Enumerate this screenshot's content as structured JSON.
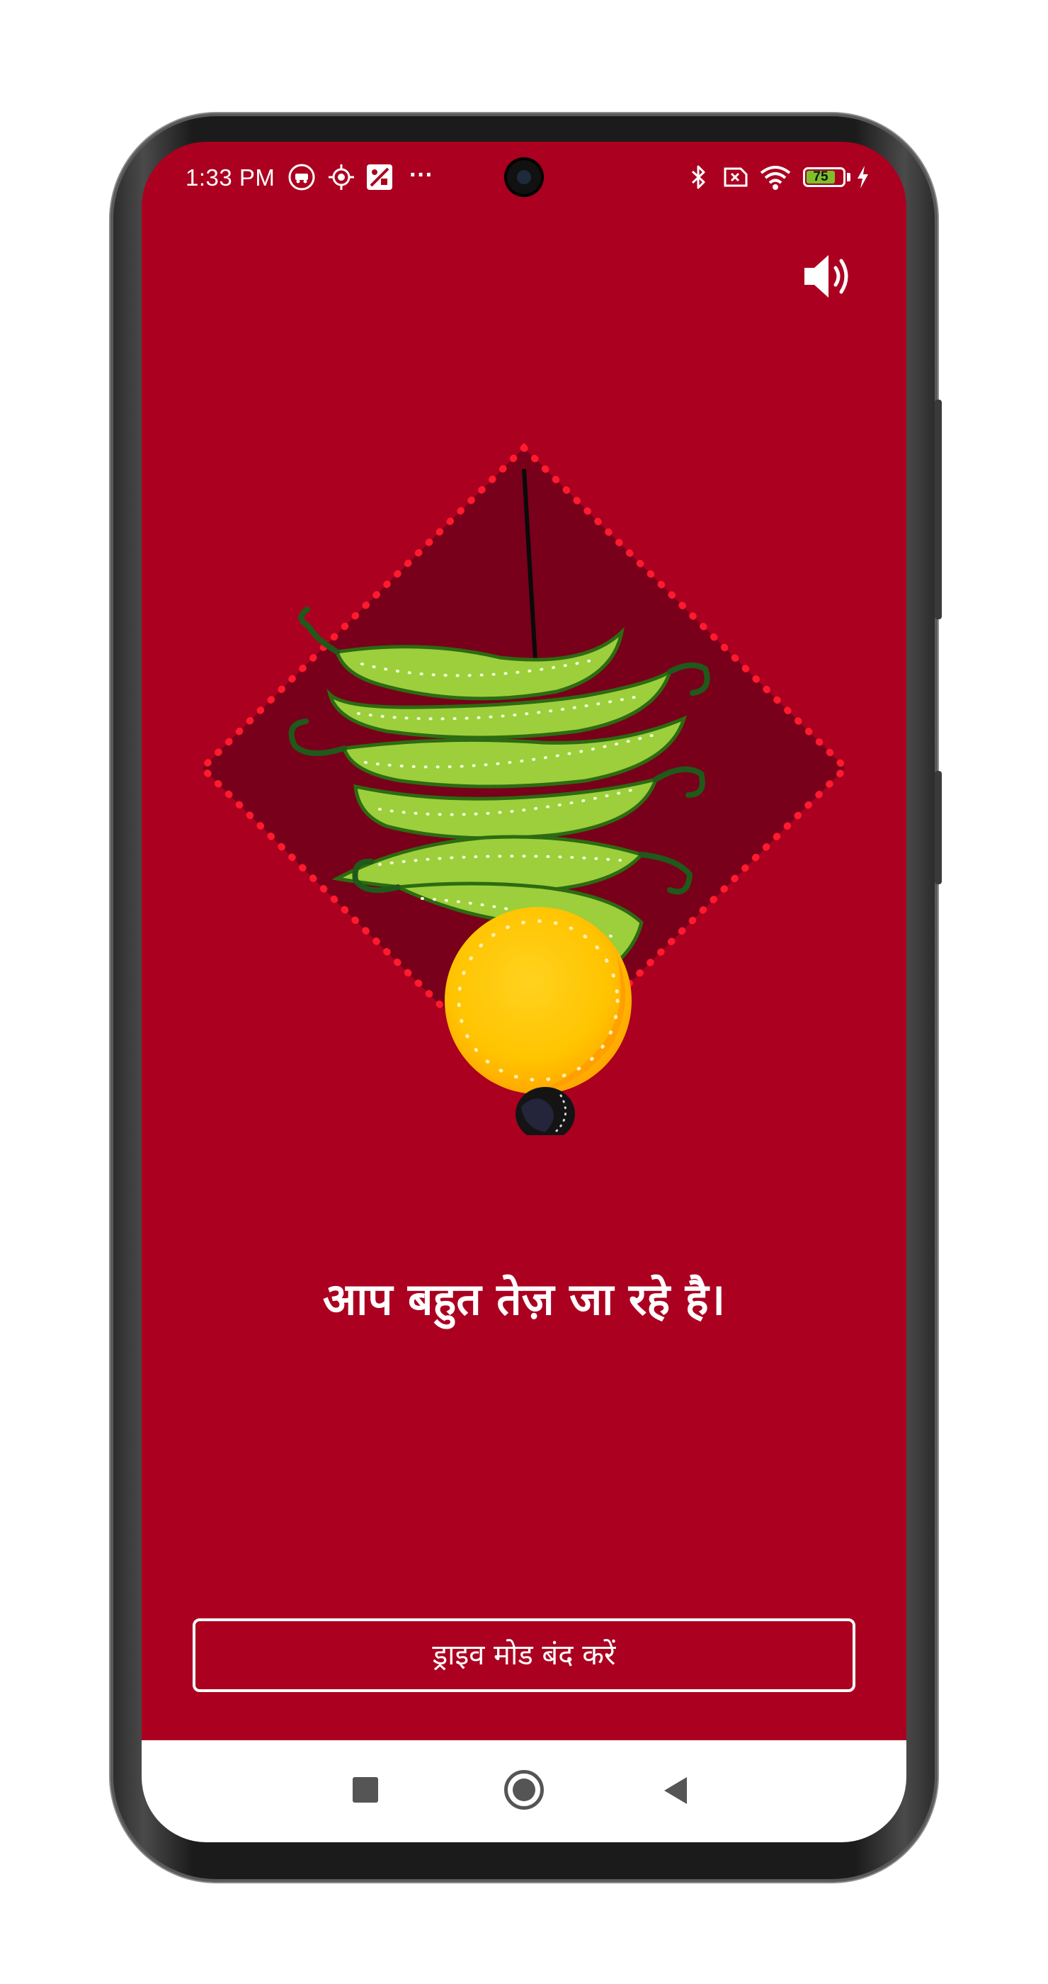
{
  "status_bar": {
    "time": "1:33 PM",
    "overflow": "···",
    "battery_level": "75",
    "left_icons": [
      "driving-mode-icon",
      "location-icon",
      "app-icon"
    ],
    "right_icons": [
      "bluetooth-icon",
      "no-sim-icon",
      "wifi-icon",
      "battery-icon",
      "charging-icon"
    ]
  },
  "header": {
    "sound_icon": "speaker-icon"
  },
  "illustration": {
    "name": "nimbu-mirchi-charm"
  },
  "message": {
    "text": "आप बहुत तेज़ जा रहे है।"
  },
  "exit_button": {
    "label": "ड्राइव मोड बंद करें"
  },
  "nav_bar": {
    "items": [
      "recents-button",
      "home-button",
      "back-button"
    ]
  },
  "colors": {
    "background": "#ab0020",
    "diamond": "#78001a",
    "dots": "#ff1a2e",
    "chili": "#9ccf3b",
    "lemon": "#ffc400",
    "text": "#ffffff"
  }
}
